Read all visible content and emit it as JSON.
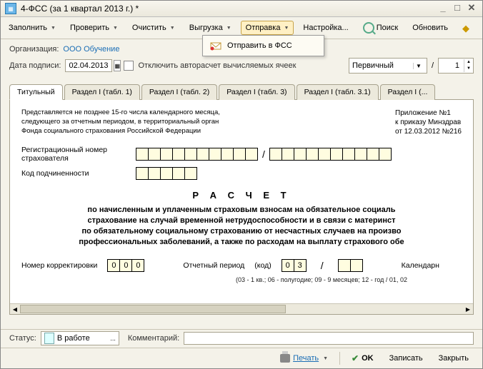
{
  "window": {
    "title": "4-ФСС (за 1 квартал 2013 г.) *"
  },
  "toolbar": {
    "fill": "Заполнить",
    "check": "Проверить",
    "clear": "Очистить",
    "export": "Выгрузка",
    "send": "Отправка",
    "settings": "Настройка...",
    "search": "Поиск",
    "refresh": "Обновить"
  },
  "dropdown": {
    "send_fss": "Отправить в ФСС"
  },
  "header": {
    "org_label": "Организация:",
    "org_value": "ООО Обучение",
    "sign_date_label": "Дата подписи:",
    "sign_date": "02.04.2013",
    "disable_calc": "Отключить авторасчет вычисляемых ячеек",
    "type": "Первичный",
    "slash": "/",
    "num": "1"
  },
  "tabs": [
    "Титульный",
    "Раздел I (табл. 1)",
    "Раздел I (табл. 2)",
    "Раздел I (табл. 3)",
    "Раздел I (табл. 3.1)",
    "Раздел I (..."
  ],
  "doc": {
    "appendix": "Приложение №1\nк приказу Минздрав\nот 12.03.2012  №216",
    "intro": "Представляется не позднее 15-го числа календарного месяца, следующего за отчетным периодом, в территориальный орган Фонда социального страхования Российской Федерации",
    "reg_label": "Регистрационный номер страхователя",
    "sub_label": "Код подчиненности",
    "title": "Р А С Ч Е Т",
    "para": "по начисленным и уплаченным страховым взносам на обязательное социаль\nстрахование на случай временной нетрудоспособности и в связи с материнст\nпо обязательному социальному страхованию от несчастных случаев на произво\nпрофессиональных заболеваний, а также по расходам на выплату страхового обе",
    "corr_label": "Номер корректировки",
    "corr": [
      "0",
      "0",
      "0"
    ],
    "period_label": "Отчетный период",
    "code_label": "(код)",
    "period": [
      "0",
      "3",
      "",
      ""
    ],
    "calendar_label": "Календарн",
    "note": "(03 - 1 кв.; 06 - полугодие; 09 - 9 месяцев; 12 - год / 01, 02"
  },
  "status": {
    "label": "Статус:",
    "value": "В работе",
    "comment_label": "Комментарий:"
  },
  "footer": {
    "print": "Печать",
    "ok": "OK",
    "save": "Записать",
    "close": "Закрыть"
  }
}
